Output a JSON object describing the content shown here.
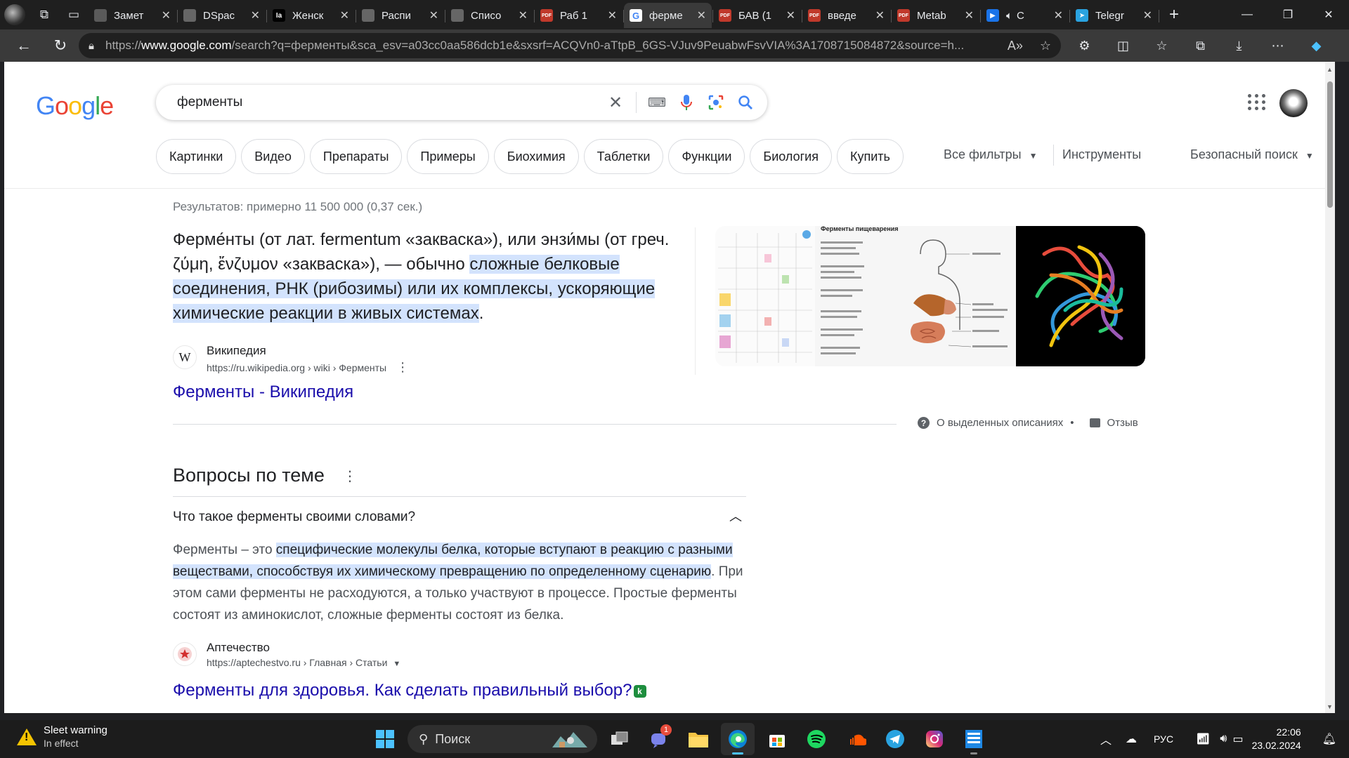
{
  "browser": {
    "tabs": [
      {
        "title": "Замет",
        "favicon": "notes-icon",
        "color": "#5a5a5a",
        "glyph": ""
      },
      {
        "title": "DSpac",
        "favicon": "page-icon",
        "color": "#666666",
        "glyph": ""
      },
      {
        "title": "Женск",
        "favicon": "ia-icon",
        "color": "#000000",
        "glyph": "Ia"
      },
      {
        "title": "Распи",
        "favicon": "page-icon",
        "color": "#666666",
        "glyph": ""
      },
      {
        "title": "Списо",
        "favicon": "page-icon",
        "color": "#666666",
        "glyph": ""
      },
      {
        "title": "Раб 1",
        "favicon": "pdf-icon",
        "color": "#c0392b",
        "glyph": "PDF"
      },
      {
        "title": "ферме",
        "favicon": "google-icon",
        "color": "#ffffff",
        "glyph": "G",
        "active": true
      },
      {
        "title": "БАВ (1",
        "favicon": "pdf-icon",
        "color": "#c0392b",
        "glyph": "PDF"
      },
      {
        "title": "введе",
        "favicon": "pdf-icon",
        "color": "#c0392b",
        "glyph": "PDF"
      },
      {
        "title": "Metab",
        "favicon": "pdf-icon",
        "color": "#c0392b",
        "glyph": "PDF"
      },
      {
        "title": "C",
        "favicon": "video-icon",
        "color": "#1a73e8",
        "glyph": "▶"
      },
      {
        "title": "Telegr",
        "favicon": "telegram-icon",
        "color": "#2aa3e0",
        "glyph": "➤"
      }
    ],
    "url_prefix": "https://",
    "url_host": "www.google.com",
    "url_rest": "/search?q=ферменты&sca_esv=a03cc0aa586dcb1e&sxsrf=ACQVn0-aTtpB_6GS-VJuv9PeuabwFsvVIA%3A1708715084872&source=h..."
  },
  "search": {
    "logo": [
      "G",
      "o",
      "o",
      "g",
      "l",
      "e"
    ],
    "logo_colors": [
      "#4285f4",
      "#ea4335",
      "#fbbc05",
      "#4285f4",
      "#34a853",
      "#ea4335"
    ],
    "query": "ферменты",
    "chips": [
      "Картинки",
      "Видео",
      "Препараты",
      "Примеры",
      "Биохимия",
      "Таблетки",
      "Функции",
      "Биология",
      "Купить"
    ],
    "all_filters": "Все фильтры",
    "tools": "Инструменты",
    "safe_search": "Безопасный поиск"
  },
  "results": {
    "stats": "Результатов: примерно 11 500 000 (0,37 сек.)",
    "featured": {
      "text_plain": "Ферме́нты (от лат. fermentum «закваска»), или энзи́мы (от греч. ζύμη, ἔνζυμον «закваска»), — обычно ",
      "text_highlight": "сложные белковые соединения, РНК (рибозимы) или их комплексы, ускоряющие химические реакции в живых системах",
      "text_end": ".",
      "source_name": "Википедия",
      "source_fav": "W",
      "source_url": "https://ru.wikipedia.org › wiki › Ферменты",
      "title": "Ферменты - Википедия",
      "image2_title": "Ферменты пищеварения"
    },
    "about_label": "О выделенных описаниях",
    "feedback_label": "Отзыв"
  },
  "paa": {
    "title": "Вопросы по теме",
    "question": "Что такое ферменты своими словами?",
    "answer_pre": "Ферменты – это ",
    "answer_highlight": "специфические молекулы белка, которые вступают в реакцию с разными веществами, способствуя их химическому превращению по определенному сценарию",
    "answer_post": ". При этом сами ферменты не расходуются, а только участвуют в процессе. Простые ферменты состоят из аминокислот, сложные ферменты состоят из белка.",
    "source_name": "Аптечество",
    "source_url": "https://aptechestvo.ru › Главная › Статьи",
    "result_title": "Ферменты для здоровья. Как сделать правильный выбор?",
    "badge": "k"
  },
  "taskbar": {
    "weather_title": "Sleet warning",
    "weather_sub": "In effect",
    "search_label": "Поиск",
    "teams_badge": "1",
    "language": "РУС",
    "time": "22:06",
    "date": "23.02.2024"
  }
}
